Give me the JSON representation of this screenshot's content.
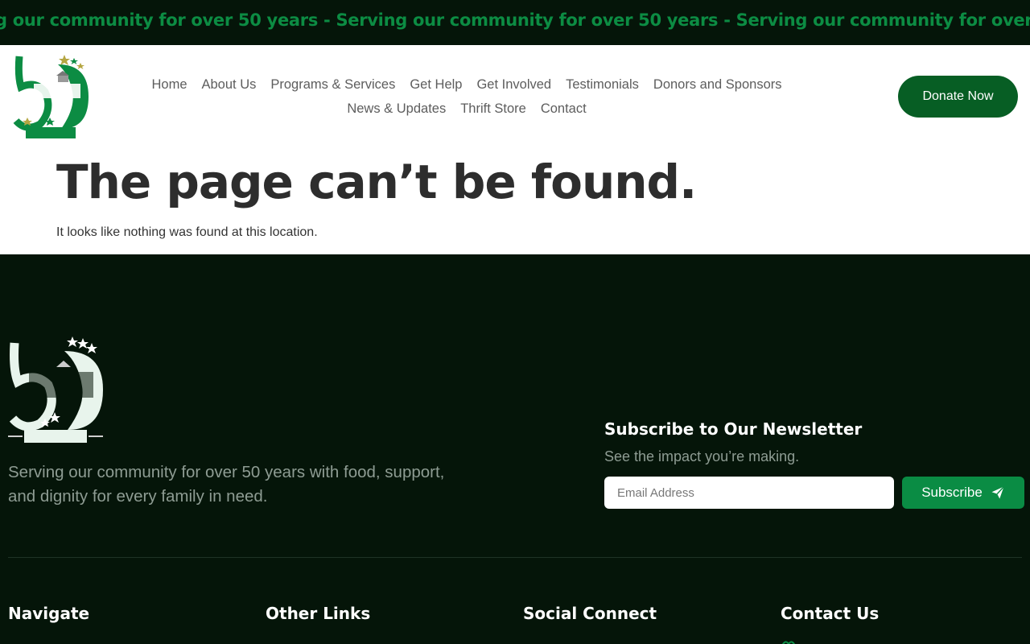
{
  "ticker": {
    "text": "g our community for over 50 years - Serving our community for over 50 years - Serving our community for over 50 years - Serving"
  },
  "header": {
    "nav": [
      "Home",
      "About Us",
      "Programs & Services",
      "Get Help",
      "Get Involved",
      "Testimonials",
      "Donors and Sponsors",
      "News & Updates",
      "Thrift Store",
      "Contact"
    ],
    "donate_label": "Donate Now"
  },
  "not_found": {
    "title": "The page can’t be found.",
    "subtitle": "It looks like nothing was found at this location."
  },
  "footer": {
    "tagline": "Serving our community for over 50 years with food, support, and dignity for every family in need.",
    "newsletter": {
      "title": "Subscribe to Our Newsletter",
      "subtitle": "See the impact you’re making.",
      "email_placeholder": "Email Address",
      "subscribe_label": "Subscribe"
    },
    "columns": [
      "Navigate",
      "Other Links",
      "Social Connect",
      "Contact Us"
    ]
  },
  "colors": {
    "dark_bg": "#051509",
    "brand_green": "#075e24",
    "accent_green": "#0a8c44"
  },
  "icons": {
    "subscribe": "send-icon"
  }
}
